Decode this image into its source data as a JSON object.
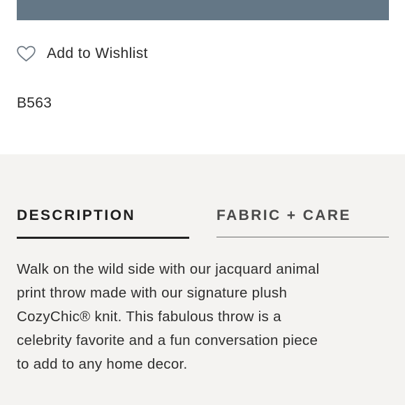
{
  "colors": {
    "top_bar": "#647786",
    "panel_background": "#f4f3f1",
    "text": "#2b2b2b"
  },
  "wishlist": {
    "label": "Add to Wishlist",
    "icon": "heart-outline-icon"
  },
  "product": {
    "sku": "B563"
  },
  "tabs": [
    {
      "label": "DESCRIPTION",
      "active": true
    },
    {
      "label": "FABRIC + CARE",
      "active": false
    }
  ],
  "description": {
    "lines": [
      "Walk on the wild side with our jacquard animal",
      "print throw made with our signature plush",
      "CozyChic® knit. This fabulous throw is a",
      "celebrity favorite and a fun conversation piece",
      "to add to any home decor."
    ]
  }
}
